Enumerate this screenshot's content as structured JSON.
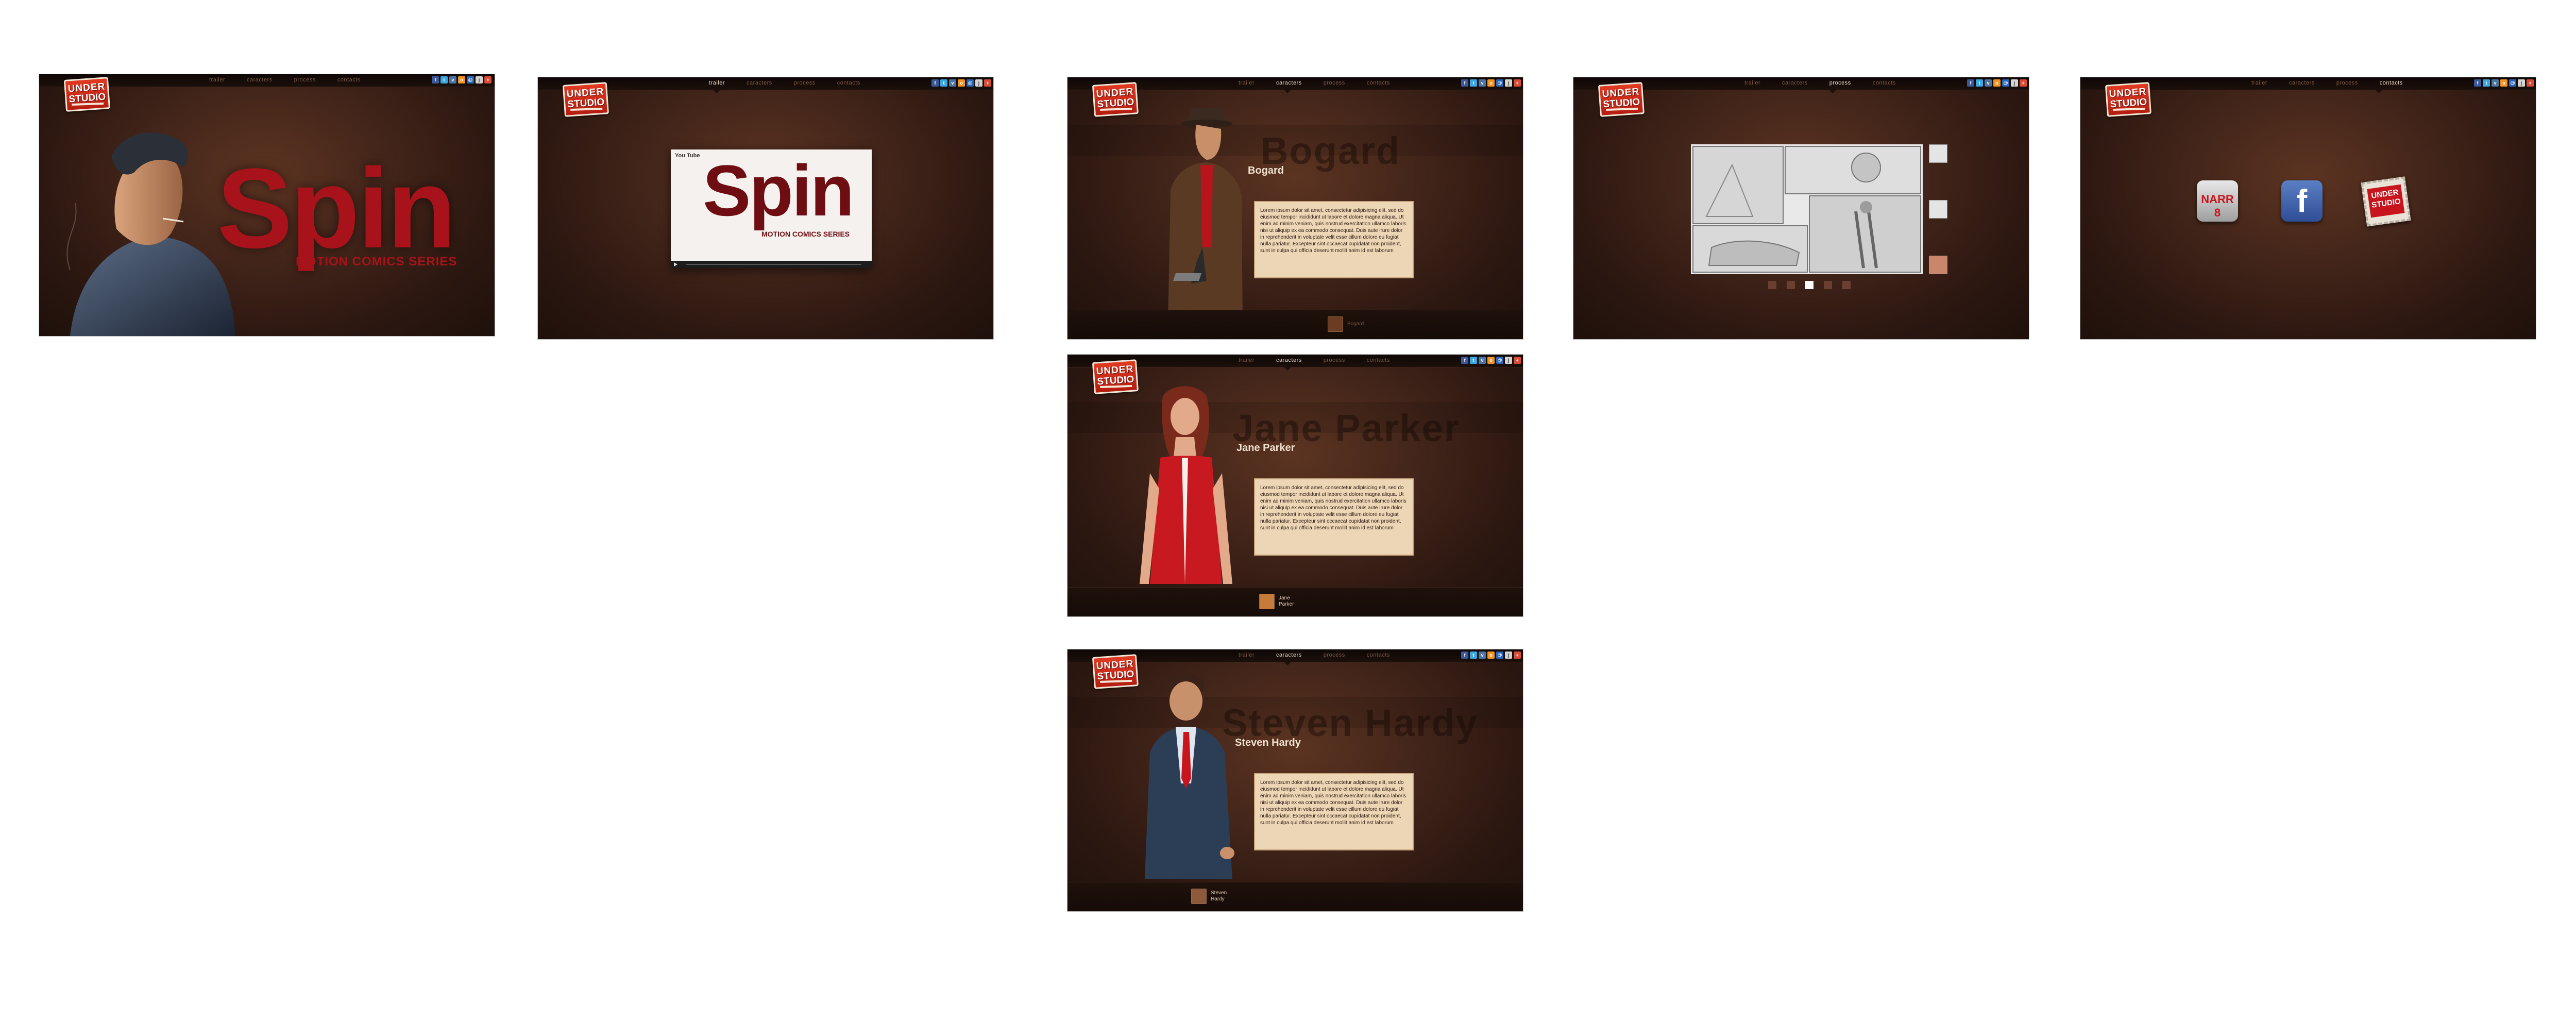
{
  "brand": {
    "logo_line1": "UNDER",
    "logo_line2": "STUDIO"
  },
  "nav": [
    "trailer",
    "caracters",
    "process",
    "contacts"
  ],
  "social_icons": [
    "facebook-icon",
    "twitter-icon",
    "vkontakte-icon",
    "odnoklassniki-icon",
    "mail-icon",
    "livejournal-icon",
    "plus-icon"
  ],
  "colors": {
    "accent_red": "#c8151d",
    "bg_brown": "#3a2016",
    "text_light": "#f1e2d0"
  },
  "screens": {
    "home": {
      "title": "Spin",
      "subtitle": "MOTION COMICS SERIES"
    },
    "trailer": {
      "youtube_label": "You Tube",
      "video_title": "Spin",
      "video_subtitle": "MOTION COMICS SERIES"
    },
    "bogard": {
      "bg_name": "Bogard",
      "name": "Bogard",
      "description": "Lorem ipsum dolor sit amet, consectetur adipisicing elit, sed do eiusmod tempor incididunt ut labore et dolore magna aliqua. Ut enim ad minim veniam, quis nostrud exercitation ullamco laboris nisi ut aliquip ex ea commodo consequat. Duis aute irure dolor in reprehenderit in voluptate velit esse cillum dolore eu fugiat nulla pariatur. Excepteur sint occaecat cupidatat non proident, sunt in culpa qui officia deserunt mollit anim id est laborum",
      "thumb_label": "Bogard"
    },
    "jane": {
      "bg_name": "Jane Parker",
      "name": "Jane Parker",
      "description": "Lorem ipsum dolor sit amet, consectetur adipisicing elit, sed do eiusmod tempor incididunt ut labore et dolore magna aliqua. Ut enim ad minim veniam, quis nostrud exercitation ullamco laboris nisi ut aliquip ex ea commodo consequat. Duis aute irure dolor in reprehenderit in voluptate velit esse cillum dolore eu fugiat nulla pariatur. Excepteur sint occaecat cupidatat non proident, sunt in culpa qui officia deserunt mollit anim id est laborum",
      "thumb_label_1": "Jane",
      "thumb_label_2": "Parker"
    },
    "steven": {
      "bg_name": "Steven Hardy",
      "name": "Steven Hardy",
      "description": "Lorem ipsum dolor sit amet, consectetur adipisicing elit, sed do eiusmod tempor incididunt ut labore et dolore magna aliqua. Ut enim ad minim veniam, quis nostrud exercitation ullamco laboris nisi ut aliquip ex ea commodo consequat. Duis aute irure dolor in reprehenderit in voluptate velit esse cillum dolore eu fugiat nulla pariatur. Excepteur sint occaecat cupidatat non proident, sunt in culpa qui officia deserunt mollit anim id est laborum",
      "thumb_label_1": "Steven",
      "thumb_label_2": "Hardy"
    },
    "process": {
      "pager_count": 5,
      "pager_active": 3
    },
    "contacts": {
      "icons": [
        "narr8-icon",
        "facebook-icon",
        "under-studio-stamp-icon"
      ],
      "narr8_label": "NARR 8",
      "facebook_label": "f",
      "stamp_line1": "UNDER",
      "stamp_line2": "STUDIO"
    }
  }
}
